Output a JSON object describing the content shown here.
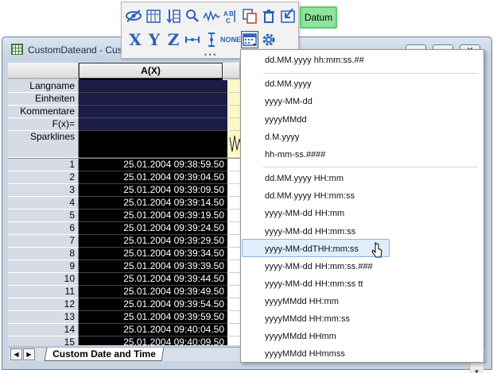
{
  "window": {
    "title": "CustomDateand - Cust",
    "buttons": [
      "─",
      "▭",
      "✕"
    ]
  },
  "column_header": "A(X)",
  "row_labels": [
    "Langname",
    "Einheiten",
    "Kommentare",
    "F(x)=",
    "Sparklines"
  ],
  "rows": [
    {
      "n": "1",
      "v": "25.01.2004 09:38:59.50"
    },
    {
      "n": "2",
      "v": "25.01.2004 09:39:04.50"
    },
    {
      "n": "3",
      "v": "25.01.2004 09:39:09.50"
    },
    {
      "n": "4",
      "v": "25.01.2004 09:39:14.50"
    },
    {
      "n": "5",
      "v": "25.01.2004 09:39:19.50"
    },
    {
      "n": "6",
      "v": "25.01.2004 09:39:24.50"
    },
    {
      "n": "7",
      "v": "25.01.2004 09:39:29.50"
    },
    {
      "n": "8",
      "v": "25.01.2004 09:39:34.50"
    },
    {
      "n": "9",
      "v": "25.01.2004 09:39:39.50"
    },
    {
      "n": "10",
      "v": "25.01.2004 09:39:44.50"
    },
    {
      "n": "11",
      "v": "25.01.2004 09:39:49.50"
    },
    {
      "n": "12",
      "v": "25.01.2004 09:39:54.50"
    },
    {
      "n": "13",
      "v": "25.01.2004 09:39:59.50"
    },
    {
      "n": "14",
      "v": "25.01.2004 09:40:04.50"
    },
    {
      "n": "15",
      "v": "25.01.2004 09:40:09.50"
    }
  ],
  "sheet_tab": "Custom Date and Time",
  "toolbar": {
    "datum_label": "Datum",
    "none_label": "NONE",
    "x_label": "X",
    "y_label": "Y",
    "z_label": "Z",
    "icons": [
      "eye-icon",
      "column-width-icon",
      "sort-icon",
      "search-icon",
      "wave-icon",
      "abc-icon",
      "copy-icon",
      "delete-icon",
      "import-icon",
      "calendar-icon",
      "gear-icon"
    ]
  },
  "menu_items": [
    "dd.MM.yyyy hh:mm:ss.##",
    "dd.MM.yyyy",
    "yyyy-MM-dd",
    "yyyyMMdd",
    "d.M.yyyy",
    "hh-mm-ss.####",
    "dd.MM.yyyy HH:mm",
    "dd.MM.yyyy HH:mm:ss",
    "yyyy-MM-dd HH:mm",
    "yyyy-MM-dd HH:mm:ss",
    "yyyy-MM-ddTHH:mm:ss",
    "yyyy-MM-dd HH:mm:ss.###",
    "yyyy-MM-dd HH:mm:ss tt",
    "yyyyMMdd HH:mm",
    "yyyyMMdd HH:mm:ss",
    "yyyyMMdd HHmm",
    "yyyyMMdd HHmmss"
  ],
  "highlighted_item": "yyyy-MM-ddTHH:mm:ss",
  "colors": {
    "highlight": "#dfeefc",
    "datum": "#8fe39c",
    "selected_column": "#000000"
  }
}
